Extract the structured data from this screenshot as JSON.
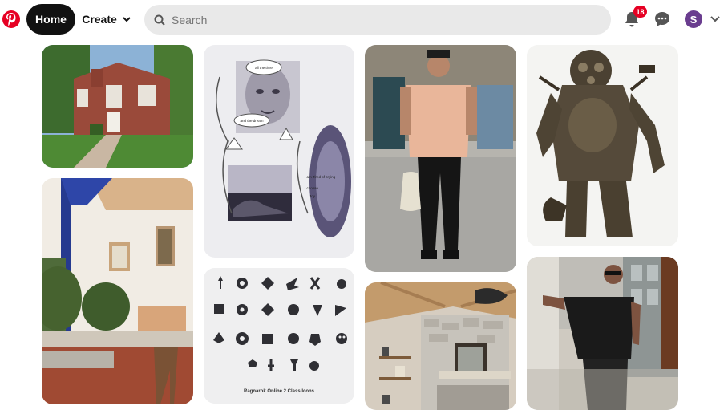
{
  "header": {
    "home_label": "Home",
    "create_label": "Create",
    "search_placeholder": "Search",
    "notifications_count": "18",
    "avatar_initial": "S"
  },
  "brand": {
    "color": "#e60023"
  },
  "pins": [
    {
      "name": "pin-brick-house"
    },
    {
      "name": "pin-poster-illustration",
      "texts": [
        "all the time",
        "and the dream",
        "I am Tired of crying",
        "I choose",
        "Joy"
      ]
    },
    {
      "name": "pin-man-street-style"
    },
    {
      "name": "pin-diving-suit-statue"
    },
    {
      "name": "pin-interior-blue-beam"
    },
    {
      "name": "pin-ragnarok-icons",
      "caption": "Ragnarok Online 2 Class Icons"
    },
    {
      "name": "pin-stone-fireplace-interior"
    },
    {
      "name": "pin-man-black-shirt"
    }
  ]
}
